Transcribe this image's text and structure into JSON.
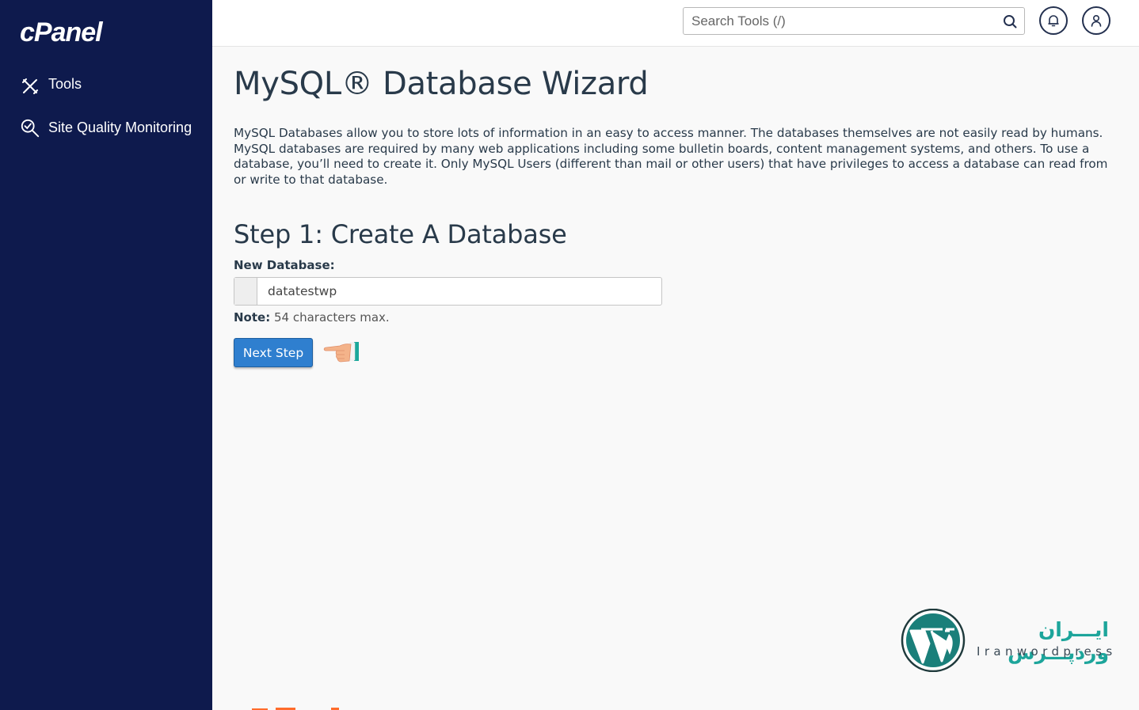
{
  "sidebar": {
    "logo": "cPanel",
    "items": [
      {
        "label": "Tools",
        "icon": "tools-icon"
      },
      {
        "label": "Site Quality Monitoring",
        "icon": "site-quality-icon"
      }
    ]
  },
  "header": {
    "search_placeholder": "Search Tools (/)",
    "icons": [
      "search-icon",
      "bell-icon",
      "user-icon"
    ]
  },
  "main": {
    "title": "MySQL® Database Wizard",
    "description": "MySQL Databases allow you to store lots of information in an easy to access manner. The databases themselves are not easily read by humans. MySQL databases are required by many web applications including some bulletin boards, content management systems, and others. To use a database, you’ll need to create it. Only MySQL Users (different than mail or other users) that have privileges to access a database can read from or write to that database.",
    "step_title": "Step 1: Create A Database",
    "field_label": "New Database:",
    "field_value": "datatestwp",
    "note_label": "Note:",
    "note_text": " 54 characters max.",
    "next_button": "Next Step"
  },
  "watermark": {
    "fa_text": "ایـــران وردپـــرس",
    "en_text": "Iranwordpress"
  },
  "colors": {
    "sidebar_bg": "#0e1a4d",
    "button_bg": "#2f7fcf",
    "watermark_teal": "#1da59b"
  }
}
